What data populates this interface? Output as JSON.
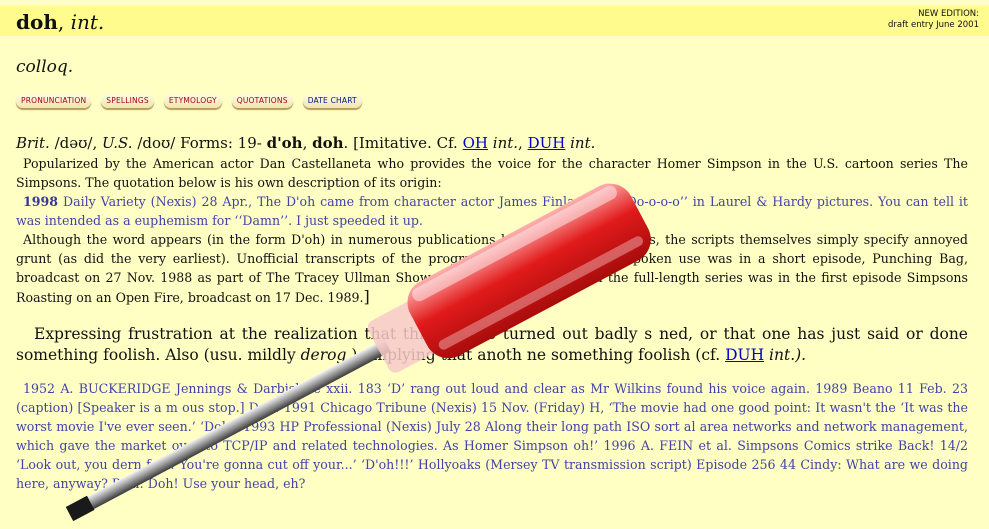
{
  "header": {
    "headword": "doh",
    "part_of_speech": "int.",
    "edition_line1": "NEW EDITION:",
    "edition_line2": "draft entry June 2001"
  },
  "usage_label": "colloq.",
  "nav": [
    {
      "label": "PRONUNCIATION",
      "color": "#a3001d"
    },
    {
      "label": "SPELLINGS",
      "color": "#a3001d"
    },
    {
      "label": "ETYMOLOGY",
      "color": "#a3001d"
    },
    {
      "label": "QUOTATIONS",
      "color": "#a3001d"
    },
    {
      "label": "DATE CHART",
      "color": "#00138a"
    }
  ],
  "forms": {
    "text1": "Brit.",
    "text2": " /dəʊ/, ",
    "text3": "U.S.",
    "text4": " /doʊ/  Forms: 19- ",
    "form1": "d'oh",
    "sep": ", ",
    "form2": "doh",
    "text5": ". [Imitative. Cf. ",
    "link1": "OH",
    "text6": " int.",
    "text6b": ", ",
    "link2": "DUH",
    "text7": " int."
  },
  "etymology_para": "Popularized by the American actor Dan Castellaneta who provides the voice for the character Homer Simpson in the U.S. cartoon series The Simpsons. The quotation below is his own description of its origin:",
  "etymology_quote": {
    "year": "1998",
    "text": "Daily Variety (Nexis) 28 Apr., The D'oh came from character actor James Finlayson's ‘‘Do-o-o-o’’ in Laurel & Hardy pictures. You can tell it was intended as a euphemism for ‘‘Damn’’. I just speeded it up."
  },
  "etymology_para2": "Although the word appears (in the form D'oh) in numerous publications based on The Simpsons, the scripts themselves simply specify annoyed grunt (as did the very earliest). Unofficial transcripts of the programme suggest the first spoken use was in a short episode, Punching Bag, broadcast on 27 Nov. 1988 as part of The Tracey Ullman Show. Its earliest occurrence in the full-length series was in the first episode Simpsons Roasting on an Open Fire, broadcast on 17 Dec. 1989.",
  "bracket_close": "]",
  "sense": {
    "text_a": "Expressing frustration at the realization that things have turned out badly ",
    "text_b": "s                                  ned, or that one has just said or done something foolish. Also (usu. mildly ",
    "derog": "derog.",
    "text_c": "): implying that anoth                                                         ne something foolish (cf. ",
    "link": "DUH",
    "text_d": " int.)."
  },
  "quotations": "1952 A. BUCKERIDGE Jennings & Darbishire xxii. 183 ‘D’                          rang out loud and clear as Mr Wilkins found his voice again. 1989 Beano 11 Feb. 23 (caption) [Speaker is a m                    ous stop.] Doh! 1991 Chicago Tribune (Nexis) 15 Nov. (Friday) H, ‘The movie had one good point: It wasn't the                      ‘It was the worst movie I've ever seen.’ ‘Doh!’ 1993 HP Professional (Nexis) July 28 Along their long path ISO sort                    al area networks and network management, which gave the market over to TCP/IP and related technologies. As Homer Simpson                   oh!’ 1996 A. FEIN et al. Simpsons Comics strike Back! 14/2 ‘Look out, you dern fool! You're gonna cut off your...’ ‘D'oh!!!’                 Hollyoaks (Mersey TV transmission script) Episode 256 44 Cindy: What are we doing here, anyway? Paul: Doh! Use your head, eh?",
  "colors": {
    "background": "#ffffc4",
    "header_band": "#fffb8c",
    "quote_text": "#4242a8",
    "link": "#0000cc",
    "screwdriver_handle": "#e11a1a"
  }
}
